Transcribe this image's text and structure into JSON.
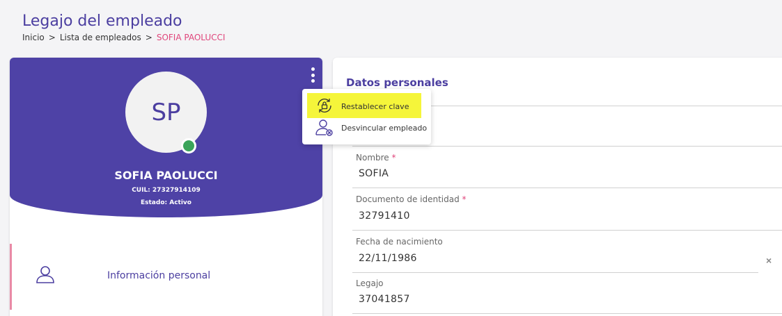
{
  "header": {
    "title": "Legajo del empleado",
    "breadcrumb": {
      "home": "Inicio",
      "list": "Lista de empleados",
      "current": "SOFIA PAOLUCCI",
      "separator": ">"
    }
  },
  "profile": {
    "initials": "SP",
    "name": "SOFIA PAOLUCCI",
    "cuil": "CUIL: 27327914109",
    "state": "Estado: Activo"
  },
  "menu": {
    "items": [
      {
        "label": "Restablecer clave",
        "icon": "lock-reset-icon"
      },
      {
        "label": "Desvincular empleado",
        "icon": "user-remove-icon"
      }
    ]
  },
  "nav": {
    "personal_info": "Información personal"
  },
  "personal": {
    "section_title": "Datos personales",
    "fields": [
      {
        "label": "Nombre",
        "required": "*",
        "value": "SOFIA"
      },
      {
        "label": "Documento de identidad",
        "required": "*",
        "value": "32791410"
      },
      {
        "label": "Fecha de nacimiento",
        "required": "",
        "value": "22/11/1986"
      },
      {
        "label": "Legajo",
        "required": "",
        "value": "37041857"
      }
    ],
    "clear_symbol": "×"
  },
  "colors": {
    "primary": "#4e42a6",
    "accent": "#e0457b",
    "online": "#3ba45a",
    "highlight": "#f5f53a"
  }
}
